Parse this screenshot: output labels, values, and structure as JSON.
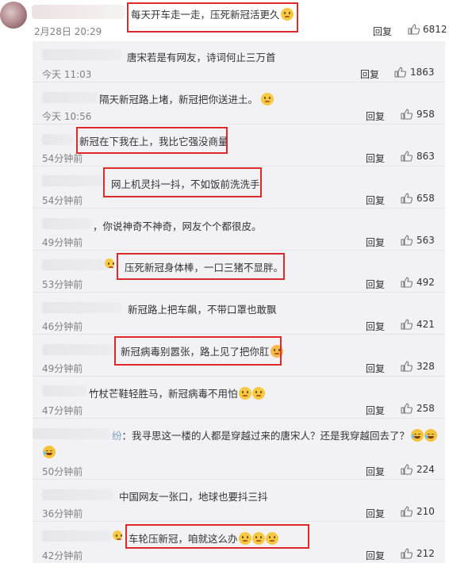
{
  "main_comment": {
    "text": "每天开车走一走，压死新冠活更久",
    "time": "2月28日 20:29",
    "reply_label": "回复",
    "likes": "6812",
    "emoji": "smile-emoji"
  },
  "replies": [
    {
      "text": "唐宋若是有网友，诗词何止三万首",
      "time": "今天 11:03",
      "reply_label": "回复",
      "likes": "1863"
    },
    {
      "text": "隔天新冠路上堵，新冠把你送进土。",
      "time": "今天 10:56",
      "reply_label": "回复",
      "likes": "958",
      "emoji": "smile-emoji"
    },
    {
      "text": "新冠在下我在上，我比它强没商量",
      "time": "54分钟前",
      "reply_label": "回复",
      "likes": "863"
    },
    {
      "text": "网上机灵抖一抖，不如饭前洗洗手",
      "time": "54分钟前",
      "reply_label": "回复",
      "likes": "658"
    },
    {
      "text": "你说神奇不神奇，网友个个都很皮。",
      "time": "49分钟前",
      "reply_label": "回复",
      "likes": "563"
    },
    {
      "text": "压死新冠身体棒，一口三猪不显胖。",
      "time": "53分钟前",
      "reply_label": "回复",
      "likes": "492"
    },
    {
      "text": "新冠路上把车飙，不带口罩也敢飘",
      "time": "46分钟前",
      "reply_label": "回复",
      "likes": "421"
    },
    {
      "text": "新冠病毒别嚣张，路上见了把你肛",
      "time": "49分钟前",
      "reply_label": "回复",
      "likes": "328",
      "emoji": "blush-emoji"
    },
    {
      "text": "竹杖芒鞋轻胜马，新冠病毒不用怕",
      "time": "47分钟前",
      "reply_label": "回复",
      "likes": "258",
      "emoji": "smile-emoji"
    },
    {
      "prefix": "纷",
      "text": "：我寻思这一楼的人都是穿越过来的唐宋人？还是我穿越回去了？",
      "time": "50分钟前",
      "reply_label": "回复",
      "likes": "224",
      "emoji": "cry-emoji"
    },
    {
      "text": "中国网友一张口，地球也要抖三抖",
      "time": "36分钟前",
      "reply_label": "回复",
      "likes": "210"
    },
    {
      "text": "车轮压新冠，咱就这么办",
      "time": "42分钟前",
      "reply_label": "回复",
      "likes": "212",
      "emoji": "smile-emoji"
    }
  ],
  "icons": {
    "like": "thumbs-up-icon"
  },
  "colors": {
    "highlight": "#e02a2a",
    "thread_bg": "#f2f2f5",
    "muted": "#808080"
  }
}
